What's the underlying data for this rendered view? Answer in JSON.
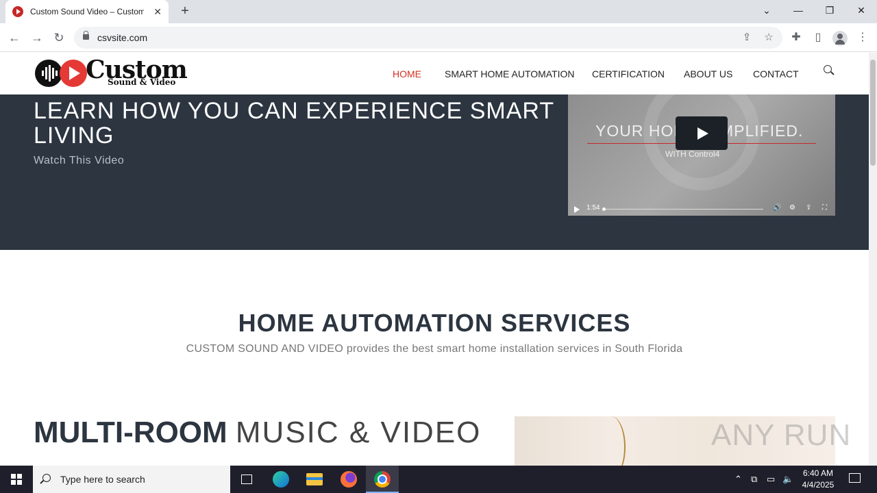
{
  "browser": {
    "tab_title": "Custom Sound Video – Custom",
    "new_tab_symbol": "+",
    "url": "csvsite.com"
  },
  "site": {
    "logo_word": "Custom",
    "logo_sub": "Sound & Video",
    "nav": [
      "HOME",
      "SMART HOME AUTOMATION",
      "CERTIFICATION",
      "ABOUT US",
      "CONTACT"
    ],
    "active_nav": "HOME",
    "colors": {
      "accent": "#d32f1e",
      "hero_bg": "#2c3540"
    }
  },
  "hero": {
    "title": "LEARN HOW YOU CAN EXPERIENCE SMART LIVING",
    "subtitle": "Watch This Video",
    "video": {
      "headline": "YOUR HOME SIMPLIFIED.",
      "brand": "WITH Control4",
      "duration": "1:54"
    }
  },
  "services": {
    "title": "HOME AUTOMATION SERVICES",
    "subtitle": "CUSTOM SOUND AND VIDEO provides the best smart home installation services in South Florida"
  },
  "feature": {
    "title_bold": "MULTI-ROOM",
    "title_light": "MUSIC & VIDEO"
  },
  "watermark": "ANY RUN",
  "taskbar": {
    "search_placeholder": "Type here to search",
    "time": "6:40 AM",
    "date": "4/4/2025"
  }
}
